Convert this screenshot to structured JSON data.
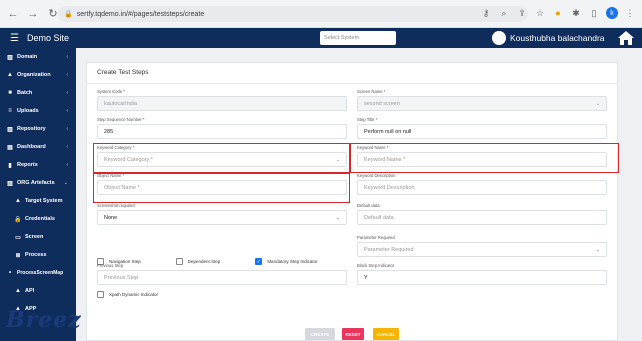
{
  "browser": {
    "url": "sertfy.tqdemo.in/#/pages/teststeps/create",
    "profile_initial": "k"
  },
  "header": {
    "menu_icon": "hamburger-icon",
    "app_title": "Demo Site",
    "system_select_placeholder": "Select System",
    "user_name": "Kousthubha balachandra",
    "home_icon": "home-icon"
  },
  "sidebar": {
    "items": [
      {
        "label": "Domain",
        "icon": "bar-chart-icon",
        "chev": "‹"
      },
      {
        "label": "Organization",
        "icon": "graduation-cap-icon",
        "chev": "‹"
      },
      {
        "label": "Batch",
        "icon": "folder-icon",
        "chev": "‹"
      },
      {
        "label": "Uploads",
        "icon": "filter-icon",
        "chev": "‹"
      },
      {
        "label": "Repository",
        "icon": "bar-chart-icon",
        "chev": "‹"
      },
      {
        "label": "Dashboard",
        "icon": "dashboard-icon",
        "chev": "‹"
      },
      {
        "label": "Reports",
        "icon": "file-icon",
        "chev": "‹"
      },
      {
        "label": "ORG Artefacts",
        "icon": "bar-chart-icon",
        "chev": "⌄"
      },
      {
        "label": "Target System",
        "icon": "graduation-cap-icon"
      },
      {
        "label": "Credentials",
        "icon": "lock-icon"
      },
      {
        "label": "Screen",
        "icon": "monitor-icon"
      },
      {
        "label": "Process",
        "icon": "process-icon"
      },
      {
        "label": "ProcessScreenMap",
        "icon": "bullet-icon"
      },
      {
        "label": "API",
        "icon": "graduation-cap-icon"
      },
      {
        "label": "APP",
        "icon": "graduation-cap-icon"
      }
    ]
  },
  "form": {
    "title": "Create Test Steps",
    "system_code": {
      "label": "System Code *",
      "value": "kautocarIndia"
    },
    "screen_name": {
      "label": "Screen Name *",
      "value": "second screen"
    },
    "step_sequence": {
      "label": "Step Sequence Number *",
      "value": "285"
    },
    "step_title": {
      "label": "Step Title *",
      "value": "Perform null on null"
    },
    "keyword_category": {
      "label": "Keyword Category *",
      "placeholder": "Keyword Category *"
    },
    "keyword_name": {
      "label": "Keyword Name *",
      "placeholder": "Keyword Name *"
    },
    "object_name": {
      "label": "Object Name *",
      "placeholder": "Object Name *"
    },
    "keyword_description": {
      "label": "Keyword Description",
      "placeholder": "Keyword Description"
    },
    "screenshot_required": {
      "label": "Screenshot required",
      "value": "None"
    },
    "default_data": {
      "label": "Default data",
      "placeholder": "Default data"
    },
    "parameter_required": {
      "label": "Parameter Required",
      "placeholder": "Parameter Required"
    },
    "checks": {
      "navigation_step": "Navigation Step",
      "dependent_step": "Dependent Step",
      "mandatory_step": "Mandatory Step Indicator",
      "mandatory_checked": "✓"
    },
    "previous_step": {
      "label": "Previous Step",
      "placeholder": "Previous Step"
    },
    "block_step": {
      "label": "Block Step Indicator",
      "value": "Y"
    },
    "xpath_dynamic": "Xpath Dynamic Indicator",
    "buttons": {
      "create": "CREATE",
      "reset": "RESET",
      "cancel": "CANCEL"
    }
  },
  "watermark": "Breez"
}
